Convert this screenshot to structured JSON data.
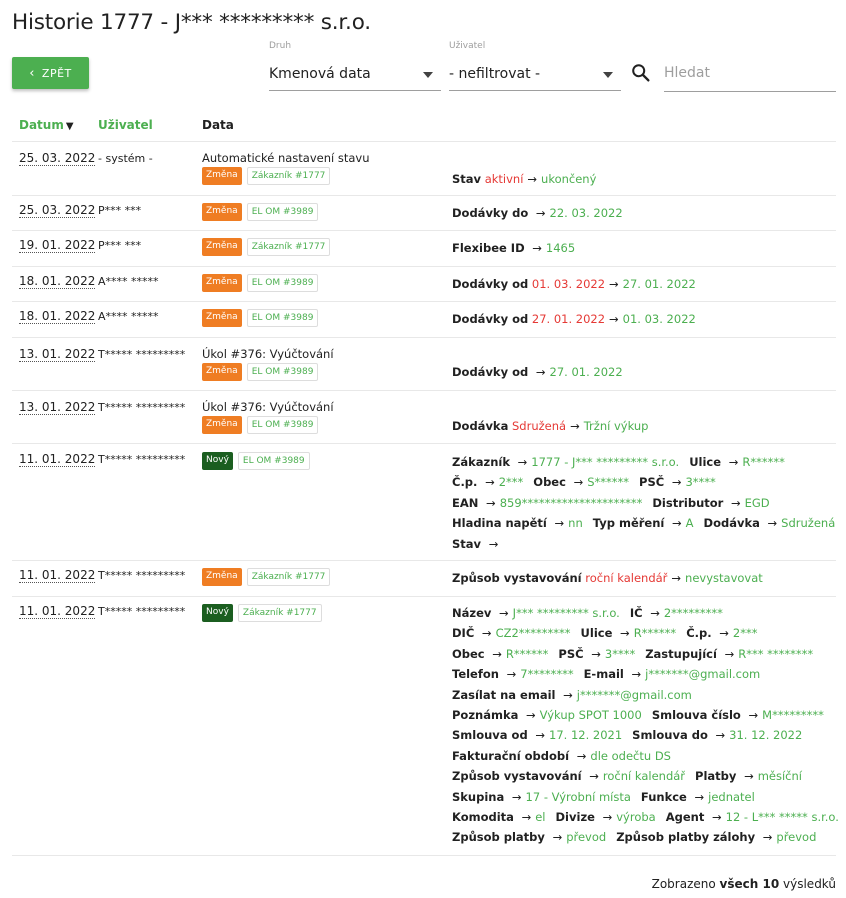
{
  "page": {
    "title": "Historie 1777 - J*** ********* s.r.o.",
    "back_label": "ZPĚT"
  },
  "filters": {
    "druh": {
      "label": "Druh",
      "value": "Kmenová data"
    },
    "uzivatel": {
      "label": "Uživatel",
      "value": "- nefiltrovat -"
    },
    "search": {
      "placeholder": "Hledat"
    }
  },
  "table": {
    "headers": {
      "date": "Datum",
      "sort_indicator": "▼",
      "user": "Uživatel",
      "data": "Data"
    },
    "rows": [
      {
        "date": "25. 03. 2022",
        "user": "- systém -",
        "desc": "Automatické nastavení stavu",
        "badge": "Změna",
        "badge_type": "zmena",
        "ref": "Zákazník #1777",
        "lines": [
          [
            {
              "k": "Stav",
              "o": "aktivní",
              "n": "ukončený"
            }
          ]
        ]
      },
      {
        "date": "25. 03. 2022",
        "user": "P*** ***",
        "desc": "",
        "badge": "Změna",
        "badge_type": "zmena",
        "ref": "EL OM #3989",
        "lines": [
          [
            {
              "k": "Dodávky do",
              "o": "",
              "n": "22. 03. 2022"
            }
          ]
        ]
      },
      {
        "date": "19. 01. 2022",
        "user": "P*** ***",
        "desc": "",
        "badge": "Změna",
        "badge_type": "zmena",
        "ref": "Zákazník #1777",
        "lines": [
          [
            {
              "k": "Flexibee ID",
              "o": "",
              "n": "1465"
            }
          ]
        ]
      },
      {
        "date": "18. 01. 2022",
        "user": "A**** *****",
        "desc": "",
        "badge": "Změna",
        "badge_type": "zmena",
        "ref": "EL OM #3989",
        "lines": [
          [
            {
              "k": "Dodávky od",
              "o": "01. 03. 2022",
              "n": "27. 01. 2022"
            }
          ]
        ]
      },
      {
        "date": "18. 01. 2022",
        "user": "A**** *****",
        "desc": "",
        "badge": "Změna",
        "badge_type": "zmena",
        "ref": "EL OM #3989",
        "lines": [
          [
            {
              "k": "Dodávky od",
              "o": "27. 01. 2022",
              "n": "01. 03. 2022"
            }
          ]
        ]
      },
      {
        "date": "13. 01. 2022",
        "user": "T***** *********",
        "desc": "Úkol #376: Vyúčtování",
        "badge": "Změna",
        "badge_type": "zmena",
        "ref": "EL OM #3989",
        "lines": [
          [
            {
              "k": "Dodávky od",
              "o": "",
              "n": "27. 01. 2022"
            }
          ]
        ]
      },
      {
        "date": "13. 01. 2022",
        "user": "T***** *********",
        "desc": "Úkol #376: Vyúčtování",
        "badge": "Změna",
        "badge_type": "zmena",
        "ref": "EL OM #3989",
        "lines": [
          [
            {
              "k": "Dodávka",
              "o": "Sdružená",
              "n": "Tržní výkup"
            }
          ]
        ]
      },
      {
        "date": "11. 01. 2022",
        "user": "T***** *********",
        "desc": "",
        "badge": "Nový",
        "badge_type": "novy",
        "ref": "EL OM #3989",
        "lines": [
          [
            {
              "k": "Zákazník",
              "o": "",
              "n": "1777 - J*** ********* s.r.o."
            },
            {
              "k": "Ulice",
              "o": "",
              "n": "R******"
            }
          ],
          [
            {
              "k": "Č.p.",
              "o": "",
              "n": "2***"
            },
            {
              "k": "Obec",
              "o": "",
              "n": "S******"
            },
            {
              "k": "PSČ",
              "o": "",
              "n": "3****"
            }
          ],
          [
            {
              "k": "EAN",
              "o": "",
              "n": "859*********************"
            },
            {
              "k": "Distributor",
              "o": "",
              "n": "EGD"
            }
          ],
          [
            {
              "k": "Hladina napětí",
              "o": "",
              "n": "nn"
            },
            {
              "k": "Typ měření",
              "o": "",
              "n": "A"
            },
            {
              "k": "Dodávka",
              "o": "",
              "n": "Sdružená"
            }
          ],
          [
            {
              "k": "Stav",
              "o": "",
              "n": ""
            }
          ]
        ]
      },
      {
        "date": "11. 01. 2022",
        "user": "T***** *********",
        "desc": "",
        "badge": "Změna",
        "badge_type": "zmena",
        "ref": "Zákazník #1777",
        "lines": [
          [
            {
              "k": "Způsob vystavování",
              "o": "roční kalendář",
              "n": "nevystavovat"
            }
          ]
        ]
      },
      {
        "date": "11. 01. 2022",
        "user": "T***** *********",
        "desc": "",
        "badge": "Nový",
        "badge_type": "novy",
        "ref": "Zákazník #1777",
        "lines": [
          [
            {
              "k": "Název",
              "o": "",
              "n": "J*** ********* s.r.o."
            },
            {
              "k": "IČ",
              "o": "",
              "n": "2*********"
            }
          ],
          [
            {
              "k": "DIČ",
              "o": "",
              "n": "CZ2*********"
            },
            {
              "k": "Ulice",
              "o": "",
              "n": "R******"
            },
            {
              "k": "Č.p.",
              "o": "",
              "n": "2***"
            }
          ],
          [
            {
              "k": "Obec",
              "o": "",
              "n": "R******"
            },
            {
              "k": "PSČ",
              "o": "",
              "n": "3****"
            },
            {
              "k": "Zastupující",
              "o": "",
              "n": "R*** ********"
            }
          ],
          [
            {
              "k": "Telefon",
              "o": "",
              "n": "7********"
            },
            {
              "k": "E-mail",
              "o": "",
              "n": "j*******@gmail.com"
            }
          ],
          [
            {
              "k": "Zasílat na email",
              "o": "",
              "n": "j*******@gmail.com"
            }
          ],
          [
            {
              "k": "Poznámka",
              "o": "",
              "n": "Výkup SPOT 1000"
            },
            {
              "k": "Smlouva číslo",
              "o": "",
              "n": "M*********"
            }
          ],
          [
            {
              "k": "Smlouva od",
              "o": "",
              "n": "17. 12. 2021"
            },
            {
              "k": "Smlouva do",
              "o": "",
              "n": "31. 12. 2022"
            }
          ],
          [
            {
              "k": "Fakturační období",
              "o": "",
              "n": "dle odečtu DS"
            }
          ],
          [
            {
              "k": "Způsob vystavování",
              "o": "",
              "n": "roční kalendář"
            },
            {
              "k": "Platby",
              "o": "",
              "n": "měsíční"
            }
          ],
          [
            {
              "k": "Skupina",
              "o": "",
              "n": "17 - Výrobní místa"
            },
            {
              "k": "Funkce",
              "o": "",
              "n": "jednatel"
            }
          ],
          [
            {
              "k": "Komodita",
              "o": "",
              "n": "el"
            },
            {
              "k": "Divize",
              "o": "",
              "n": "výroba"
            },
            {
              "k": "Agent",
              "o": "",
              "n": "12 - L*** ***** s.r.o."
            }
          ],
          [
            {
              "k": "Způsob platby",
              "o": "",
              "n": "převod"
            },
            {
              "k": "Způsob platby zálohy",
              "o": "",
              "n": "převod"
            }
          ]
        ]
      }
    ]
  },
  "footer": {
    "prefix": "Zobrazeno",
    "bold": "všech 10",
    "suffix": "výsledků"
  }
}
